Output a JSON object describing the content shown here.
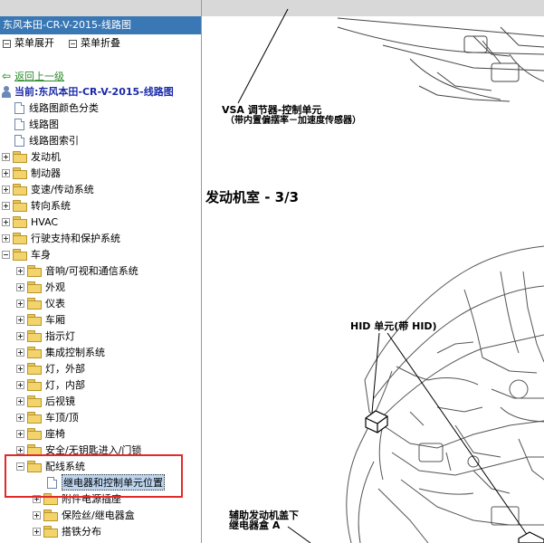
{
  "window": {
    "title": "东风本田-CR-V-2015-线路图"
  },
  "menubar": {
    "expand_label": "菜单展开",
    "collapse_label": "菜单折叠"
  },
  "tree": {
    "back_label": "返回上一级",
    "current_label": "当前:东风本田-CR-V-2015-线路图",
    "docs": [
      "线路图颜色分类",
      "线路图",
      "线路图索引"
    ],
    "folders": [
      "发动机",
      "制动器",
      "变速/传动系统",
      "转向系统",
      "HVAC",
      "行驶支持和保护系统"
    ],
    "body_folder": "车身",
    "body_children": [
      "音响/可视和通信系统",
      "外观",
      "仪表",
      "车厢",
      "指示灯",
      "集成控制系统",
      "灯，外部",
      "灯，内部",
      "后视镜",
      "车顶/顶",
      "座椅",
      "安全/无钥匙进入/门锁"
    ],
    "wiring_folder": "配线系统",
    "wiring_selected_doc": "继电器和控制单元位置",
    "wiring_children": [
      "附件电源插座",
      "保险丝/继电器盒",
      "搭铁分布"
    ]
  },
  "diagram": {
    "vsa_label_line1": "VSA 调节器-控制单元",
    "vsa_label_line2": "（带内置偏摆率－加速度传感器）",
    "section_title": "发动机室 - 3/3",
    "hid_label": "HID 单元(带 HID)",
    "aux_label_line1": "辅助发动机盖下",
    "aux_label_line2": "继电器盒 A"
  },
  "colors": {
    "titlebar": "#3a78b5",
    "highlight_box": "#e32a2a",
    "selection": "#bcd4ee"
  }
}
